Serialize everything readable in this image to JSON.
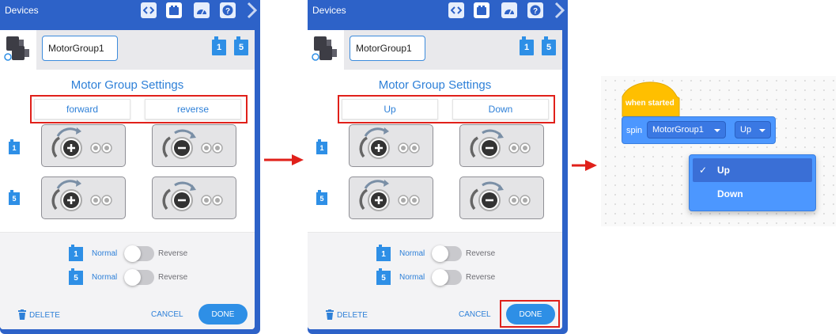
{
  "panels": [
    {
      "title": "Devices",
      "device_name": "MotorGroup1",
      "ports": [
        "1",
        "5"
      ],
      "section_title": "Motor Group Settings",
      "direction_left": "forward",
      "direction_right": "reverse",
      "normal_label": "Normal",
      "reverse_label": "Reverse",
      "delete_label": "DELETE",
      "cancel_label": "CANCEL",
      "done_label": "DONE",
      "highlighted": "direction-labels"
    },
    {
      "title": "Devices",
      "device_name": "MotorGroup1",
      "ports": [
        "1",
        "5"
      ],
      "section_title": "Motor Group Settings",
      "direction_left": "Up",
      "direction_right": "Down",
      "normal_label": "Normal",
      "reverse_label": "Reverse",
      "delete_label": "DELETE",
      "cancel_label": "CANCEL",
      "done_label": "DONE",
      "highlighted": "done-button"
    }
  ],
  "blocks": {
    "hat_label": "when started",
    "spin_label": "spin",
    "motor_field": "MotorGroup1",
    "direction_field": "Up",
    "dropdown": {
      "check": "✓",
      "options": [
        "Up",
        "Down"
      ],
      "selected": "Up"
    }
  },
  "colors": {
    "panel_blue": "#2d62c8",
    "accent_blue": "#2e8fe6",
    "highlight_red": "#e0201a",
    "block_blue": "#4c97ff",
    "hat_yellow": "#ffbf00"
  },
  "icons": [
    "code-icon",
    "devices-icon",
    "dashboard-icon",
    "help-icon",
    "chevron-right-icon",
    "motor-group-icon",
    "trash-icon",
    "plus-icon",
    "minus-icon",
    "arrow-right-icon"
  ]
}
